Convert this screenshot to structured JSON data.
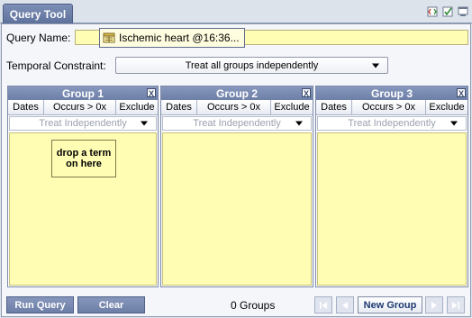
{
  "tab": {
    "title": "Query Tool"
  },
  "toolbar": {
    "icons": [
      "xml-view-icon",
      "validate-check-icon",
      "query-window-icon"
    ]
  },
  "query_name": {
    "label": "Query Name:",
    "value": "Ischemic heart @16:36..."
  },
  "temporal": {
    "label": "Temporal Constraint:",
    "selected": "Treat all groups independently"
  },
  "groups": [
    {
      "title": "Group 1",
      "tabs": [
        "Dates",
        "Occurs > 0x",
        "Exclude"
      ],
      "timing": "Treat Independently",
      "drop_hint": "drop a term on here"
    },
    {
      "title": "Group 2",
      "tabs": [
        "Dates",
        "Occurs > 0x",
        "Exclude"
      ],
      "timing": "Treat Independently"
    },
    {
      "title": "Group 3",
      "tabs": [
        "Dates",
        "Occurs > 0x",
        "Exclude"
      ],
      "timing": "Treat Independently"
    }
  ],
  "bottom": {
    "run_label": "Run Query",
    "clear_label": "Clear",
    "count_text": "0 Groups",
    "new_group_label": "New Group"
  },
  "colors": {
    "header_blue": "#6e80a8",
    "drop_yellow": "#fffcb4"
  }
}
